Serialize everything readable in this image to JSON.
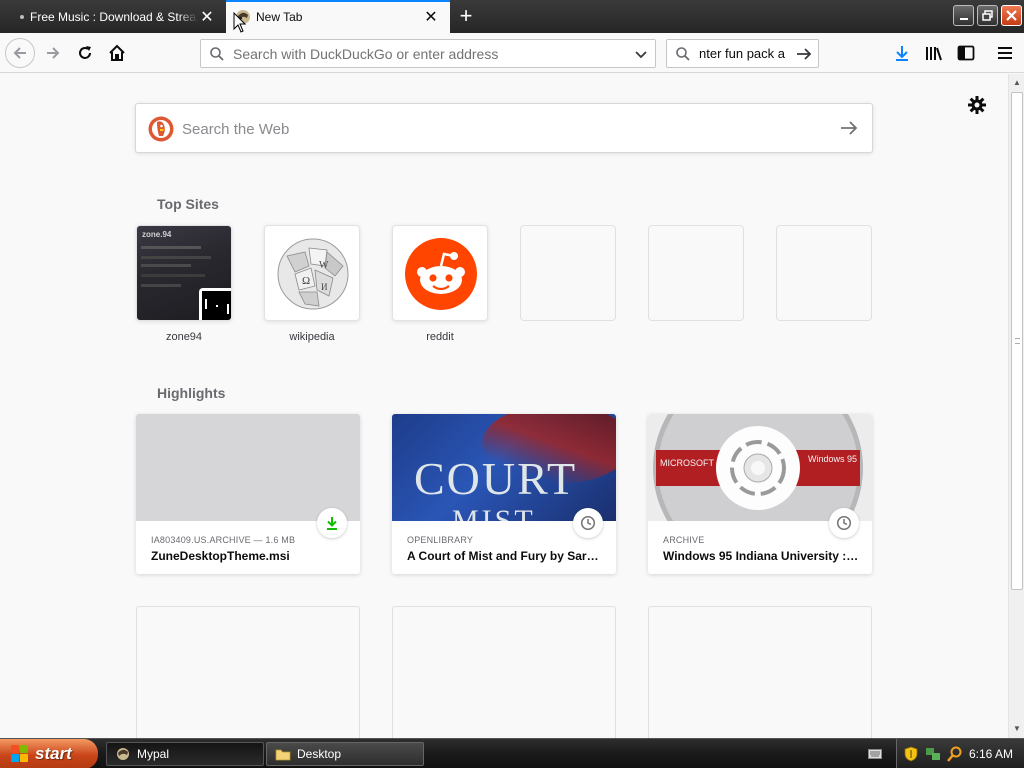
{
  "browser": {
    "tabs": [
      {
        "title": "Free Music : Download & Streaming : Internet Archive",
        "active": false
      },
      {
        "title": "New Tab",
        "active": true
      }
    ],
    "url_placeholder": "Search with DuckDuckGo or enter address",
    "search_box_value": "nter fun pack a",
    "accent_color": "#0a84ff"
  },
  "newtab": {
    "web_search_placeholder": "Search the Web",
    "top_sites_title": "Top Sites",
    "top_sites": [
      {
        "label": "zone94"
      },
      {
        "label": "wikipedia"
      },
      {
        "label": "reddit"
      },
      {
        "label": ""
      },
      {
        "label": ""
      },
      {
        "label": ""
      }
    ],
    "highlights_title": "Highlights",
    "highlights": [
      {
        "source": "IA803409.US.ARCHIVE — 1.6 MB",
        "title": "ZuneDesktopTheme.msi",
        "badge_icon": "download-icon",
        "badge_color": "#12bc00"
      },
      {
        "source": "OPENLIBRARY",
        "title": "A Court of Mist and Fury by Sara...",
        "badge_icon": "clock-icon",
        "thumb_text_1": "COURT",
        "thumb_text_2": "MIST"
      },
      {
        "source": "ARCHIVE",
        "title": "Windows 95 Indiana University : ...",
        "badge_icon": "clock-icon",
        "cd_label_left": "MICROSOFT",
        "cd_label_right": "Windows 95"
      }
    ],
    "reddit_color": "#ff4500"
  },
  "taskbar": {
    "start_label": "start",
    "tasks": [
      {
        "label": "Mypal",
        "active": true
      },
      {
        "label": "Desktop",
        "active": false
      }
    ],
    "clock": "6:16 AM"
  }
}
